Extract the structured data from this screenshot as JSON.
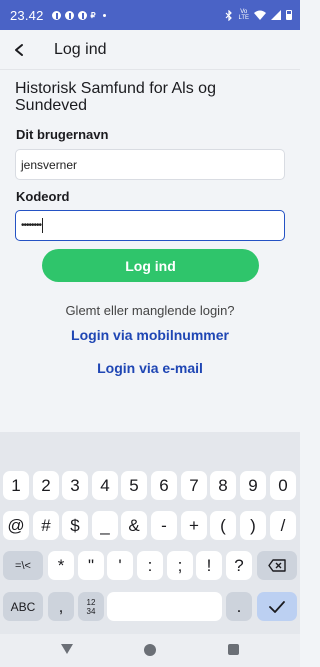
{
  "status_bar": {
    "time": "23.42",
    "notif_glyph": "₽",
    "volte_label": "Vo\nLTE",
    "icons": [
      "facebook-icon",
      "facebook-icon",
      "facebook-icon",
      "p-icon",
      "bluetooth-icon",
      "volte-icon",
      "wifi-icon",
      "signal-icon",
      "battery-icon"
    ]
  },
  "header": {
    "back_icon": "arrow-left-icon",
    "title": "Log ind"
  },
  "form": {
    "organization": "Historisk Samfund for Als og Sundeved",
    "username_label": "Dit brugernavn",
    "username_value": "jensverner",
    "password_label": "Kodeord",
    "password_value": "••••••••",
    "login_button": "Log ind"
  },
  "links": {
    "forgot_text": "Glemt eller manglende login?",
    "mobile_link": "Login via mobilnummer",
    "email_link": "Login via e-mail"
  },
  "keyboard": {
    "row1": [
      "1",
      "2",
      "3",
      "4",
      "5",
      "6",
      "7",
      "8",
      "9",
      "0"
    ],
    "row2": [
      "@",
      "#",
      "$",
      "_",
      "&",
      "-",
      "+",
      "(",
      ")",
      "/"
    ],
    "row3_left": "=\\<",
    "row3": [
      "*",
      "\"",
      "'",
      ":",
      ";",
      "!",
      "?"
    ],
    "row4_abc": "ABC",
    "row4_comma": ",",
    "row4_numpad": "12\n34",
    "row4_period": ".",
    "icons": [
      "backspace-icon",
      "checkmark-icon"
    ]
  },
  "colors": {
    "status_bar": "#4a63c6",
    "accent_green": "#2fc56b",
    "link_blue": "#1f46b4",
    "focus_border": "#2452c4"
  }
}
